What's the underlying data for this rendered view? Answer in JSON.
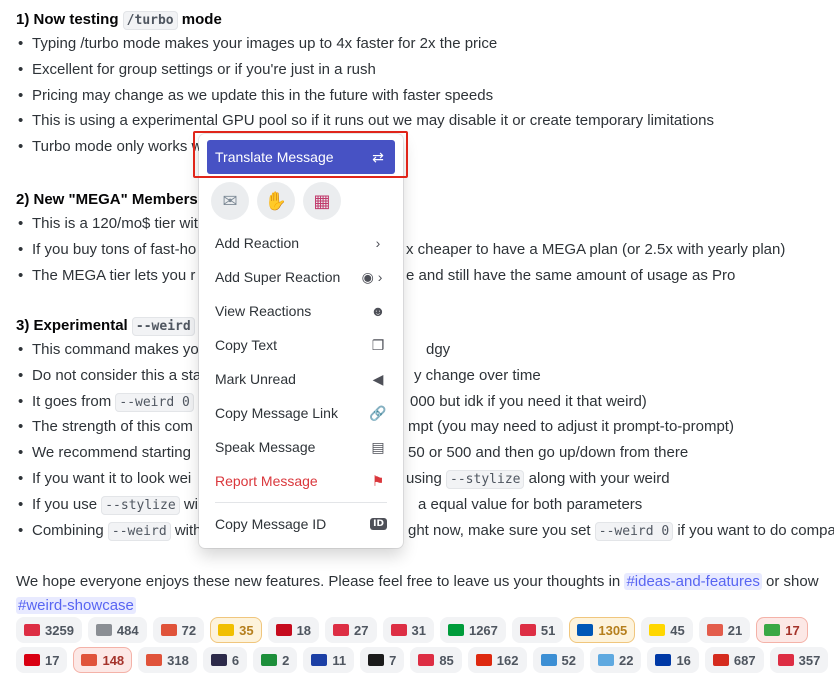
{
  "sections": [
    {
      "heading_prefix": "1) Now testing ",
      "heading_code": "/turbo",
      "heading_suffix": " mode",
      "bullets": [
        "Typing /turbo mode makes your images up to 4x faster for 2x the price",
        "Excellent for group settings or if you're just in a rush",
        "Pricing may change as we update this in the future with faster speeds",
        "This is using a experimental GPU pool so if it runs out we may disable it or create temporary limitations",
        "Turbo mode only works w"
      ]
    },
    {
      "heading_text": "2) New \"MEGA\" Members",
      "bullets": [
        "This is a 120/mo$ tier wit",
        "If you buy tons of fast-ho",
        "The MEGA tier lets you r"
      ],
      "bullet_tails": [
        "",
        "x cheaper to have a MEGA plan (or 2.5x with yearly plan)",
        "e and still have the same amount of usage as Pro"
      ]
    },
    {
      "heading_prefix": "3) Experimental ",
      "heading_code": "--weird",
      "bullets": [
        "This command makes yo",
        "Do not consider this a sta",
        "It goes from ",
        "The strength of this com",
        "We recommend starting",
        "If you want it to look wei",
        "If you use ",
        "Combining "
      ],
      "bullet_codes": [
        "",
        "",
        "--weird 0",
        "",
        "",
        "",
        "--stylize",
        "--weird"
      ],
      "bullet_suffixes": [
        "",
        "",
        "",
        "",
        "",
        "",
        " wi",
        " with"
      ],
      "bullet_tails": [
        "dgy",
        "y change over time",
        "000 but idk if you need it that weird)",
        "mpt (you may need to adjust it prompt-to-prompt)",
        "50 or 500 and then go up/down from there",
        "using ",
        "a equal value for both parameters",
        "ght now, make sure you set "
      ],
      "tail_codes": [
        "",
        "",
        "",
        "",
        "",
        "--stylize",
        "",
        "--weird 0"
      ],
      "tail_suffixes": [
        "",
        "",
        "",
        "",
        "",
        " along with your weird",
        "",
        " if you want to do compa"
      ]
    }
  ],
  "outro": {
    "text": "We hope everyone enjoys these new features. Please feel free to leave us your thoughts in ",
    "channel1": "#ideas-and-features",
    "middle": " or show",
    "channel2": "#weird-showcase"
  },
  "reactions_row1": [
    {
      "icon": "red-heart",
      "color": "#dd2e44",
      "count": "3259"
    },
    {
      "icon": "skull-crossbones",
      "color": "#8a8e94",
      "count": "484"
    },
    {
      "icon": "red-badge",
      "color": "#e0533a",
      "count": "72"
    },
    {
      "icon": "flag-spain",
      "color": "#f1bf00",
      "count": "35",
      "state": "active"
    },
    {
      "icon": "flag-spain",
      "color": "#c60b1e",
      "count": "18"
    },
    {
      "icon": "red-exclamation",
      "color": "#dd2e44",
      "count": "27"
    },
    {
      "icon": "cross-mark",
      "color": "#dd2e44",
      "count": "31"
    },
    {
      "icon": "flag-brazil",
      "color": "#009c3b",
      "count": "1267"
    },
    {
      "icon": "red-symbol",
      "color": "#dd2e44",
      "count": "51"
    },
    {
      "icon": "flag-ukraine",
      "color": "#0057b7",
      "count": "1305",
      "state": "active"
    },
    {
      "icon": "flag-ukraine",
      "color": "#ffd700",
      "count": "45"
    },
    {
      "icon": "red-heart-bandaged",
      "color": "#e35d4c",
      "count": "21"
    },
    {
      "icon": "green-invader",
      "color": "#3aa845",
      "count": "17",
      "state": "me"
    }
  ],
  "reactions_row2": [
    {
      "icon": "flag-armenia",
      "color": "#d90012",
      "count": "17"
    },
    {
      "icon": "party-popper",
      "color": "#e0533a",
      "count": "148",
      "state": "me"
    },
    {
      "icon": "party-popper",
      "color": "#e0533a",
      "count": "318"
    },
    {
      "icon": "flag-thailand",
      "color": "#2d2a4a",
      "count": "6"
    },
    {
      "icon": "flag-saudi",
      "color": "#1d8f3b",
      "count": "2"
    },
    {
      "icon": "flag-russia",
      "color": "#1c3fa5",
      "count": "11"
    },
    {
      "icon": "flag-kenya",
      "color": "#1b1b1b",
      "count": "7"
    },
    {
      "icon": "red-stamp",
      "color": "#dd2e44",
      "count": "85"
    },
    {
      "icon": "flag-china",
      "color": "#de2910",
      "count": "162"
    },
    {
      "icon": "earth-globe",
      "color": "#3c8fd4",
      "count": "52"
    },
    {
      "icon": "earth-globe",
      "color": "#5fa9e0",
      "count": "22"
    },
    {
      "icon": "flag-chile",
      "color": "#0039a6",
      "count": "16"
    },
    {
      "icon": "flag-canada",
      "color": "#d52b1e",
      "count": "687"
    },
    {
      "icon": "red-flag-badge",
      "color": "#dd2e44",
      "count": "357"
    }
  ],
  "menu": {
    "primary": {
      "label": "Translate Message",
      "icon": "translate-icon",
      "glyph": "⇄"
    },
    "quick_reactions": [
      {
        "name": "envelope",
        "glyph": "✉"
      },
      {
        "name": "vulcan-hand",
        "glyph": "✋"
      },
      {
        "name": "pixel-art",
        "glyph": "▦"
      }
    ],
    "items": [
      {
        "label": "Add Reaction",
        "icon": "chevron-right",
        "glyph": "›"
      },
      {
        "label": "Add Super Reaction",
        "icon": "super-reaction-chevron",
        "glyph": "◉ ›"
      },
      {
        "label": "View Reactions",
        "icon": "smiley",
        "glyph": "☻"
      },
      {
        "label": "Copy Text",
        "icon": "copy",
        "glyph": "❐"
      },
      {
        "label": "Mark Unread",
        "icon": "mark-unread",
        "glyph": "◀"
      },
      {
        "label": "Copy Message Link",
        "icon": "link",
        "glyph": "🔗"
      },
      {
        "label": "Speak Message",
        "icon": "speak",
        "glyph": "▤"
      },
      {
        "label": "Report Message",
        "icon": "flag",
        "glyph": "⚑",
        "danger": true
      }
    ],
    "copy_id": {
      "label": "Copy Message ID",
      "badge": "ID"
    }
  },
  "colors": {
    "accent": "#5865f2",
    "highlight_outline": "#e0251a",
    "primary_item": "#4752c4",
    "danger": "#da373c"
  }
}
